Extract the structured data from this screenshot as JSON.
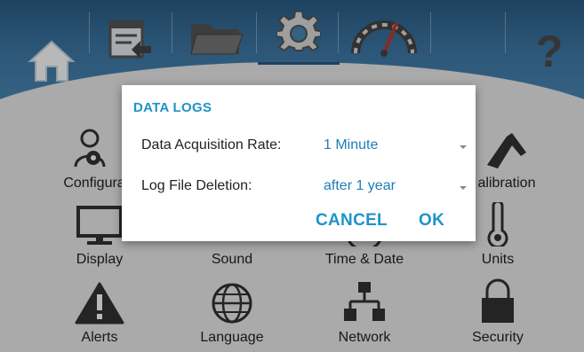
{
  "toolbar": {
    "icons": [
      "home-icon",
      "log-export-icon",
      "folder-icon",
      "gear-icon",
      "gauge-icon",
      "help-icon"
    ],
    "help_label": "?",
    "colors": {
      "bar": "#3f7aa8",
      "bar_dark": "#2b5d86"
    }
  },
  "grid": {
    "tiles": [
      {
        "label": "Configura",
        "icon": "user-config-icon"
      },
      {
        "label": "alibration",
        "icon": "caliper-icon"
      },
      {
        "label": "Display",
        "icon": "monitor-icon"
      },
      {
        "label": "Sound",
        "icon": "speaker-icon"
      },
      {
        "label": "Time & Date",
        "icon": "clock-icon"
      },
      {
        "label": "Units",
        "icon": "thermometer-icon"
      },
      {
        "label": "Alerts",
        "icon": "warning-icon"
      },
      {
        "label": "Language",
        "icon": "globe-icon"
      },
      {
        "label": "Network",
        "icon": "network-icon"
      },
      {
        "label": "Security",
        "icon": "lock-icon"
      }
    ]
  },
  "dialog": {
    "title": "DATA LOGS",
    "rows": [
      {
        "label": "Data Acquisition Rate:",
        "value": "1 Minute"
      },
      {
        "label": "Log File Deletion:",
        "value": "after 1 year"
      }
    ],
    "cancel_label": "CANCEL",
    "ok_label": "OK",
    "accent": "#1f93c9"
  }
}
